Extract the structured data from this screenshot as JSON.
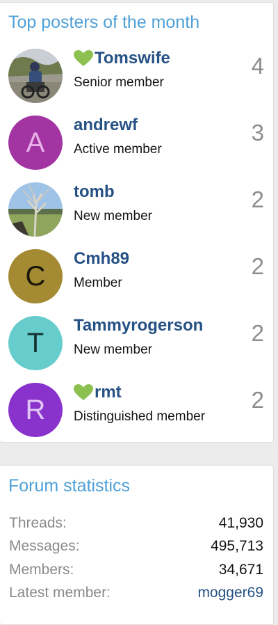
{
  "posters_block": {
    "title": "Top posters of the month",
    "members": [
      {
        "name": "Tomswife",
        "title": "Senior member",
        "count": "4",
        "heart": true,
        "avatar": {
          "type": "photo",
          "letter": "",
          "color": ""
        }
      },
      {
        "name": "andrewf",
        "title": "Active member",
        "count": "3",
        "heart": false,
        "avatar": {
          "type": "letter",
          "letter": "A",
          "color": "#a335a3"
        }
      },
      {
        "name": "tomb",
        "title": "New member",
        "count": "2",
        "heart": false,
        "avatar": {
          "type": "photo",
          "letter": "",
          "color": ""
        }
      },
      {
        "name": "Cmh89",
        "title": "Member",
        "count": "2",
        "heart": false,
        "avatar": {
          "type": "letter",
          "letter": "C",
          "color": "#a38a33"
        }
      },
      {
        "name": "Tammyrogerson",
        "title": "New member",
        "count": "2",
        "heart": false,
        "avatar": {
          "type": "letter",
          "letter": "T",
          "color": "#66cccc"
        }
      },
      {
        "name": "rmt",
        "title": "Distinguished member",
        "count": "2",
        "heart": true,
        "avatar": {
          "type": "letter",
          "letter": "R",
          "color": "#8a33cc"
        }
      }
    ]
  },
  "stats_block": {
    "title": "Forum statistics",
    "rows": [
      {
        "label": "Threads:",
        "value": "41,930"
      },
      {
        "label": "Messages:",
        "value": "495,713"
      },
      {
        "label": "Members:",
        "value": "34,671"
      },
      {
        "label": "Latest member:",
        "value": "mogger69"
      }
    ]
  },
  "colors": {
    "accent": "#4fa0d6",
    "username": "#265184",
    "heart": "#8cc152",
    "count": "#8c8c8c"
  },
  "icons": {
    "heart": "heart-icon"
  }
}
